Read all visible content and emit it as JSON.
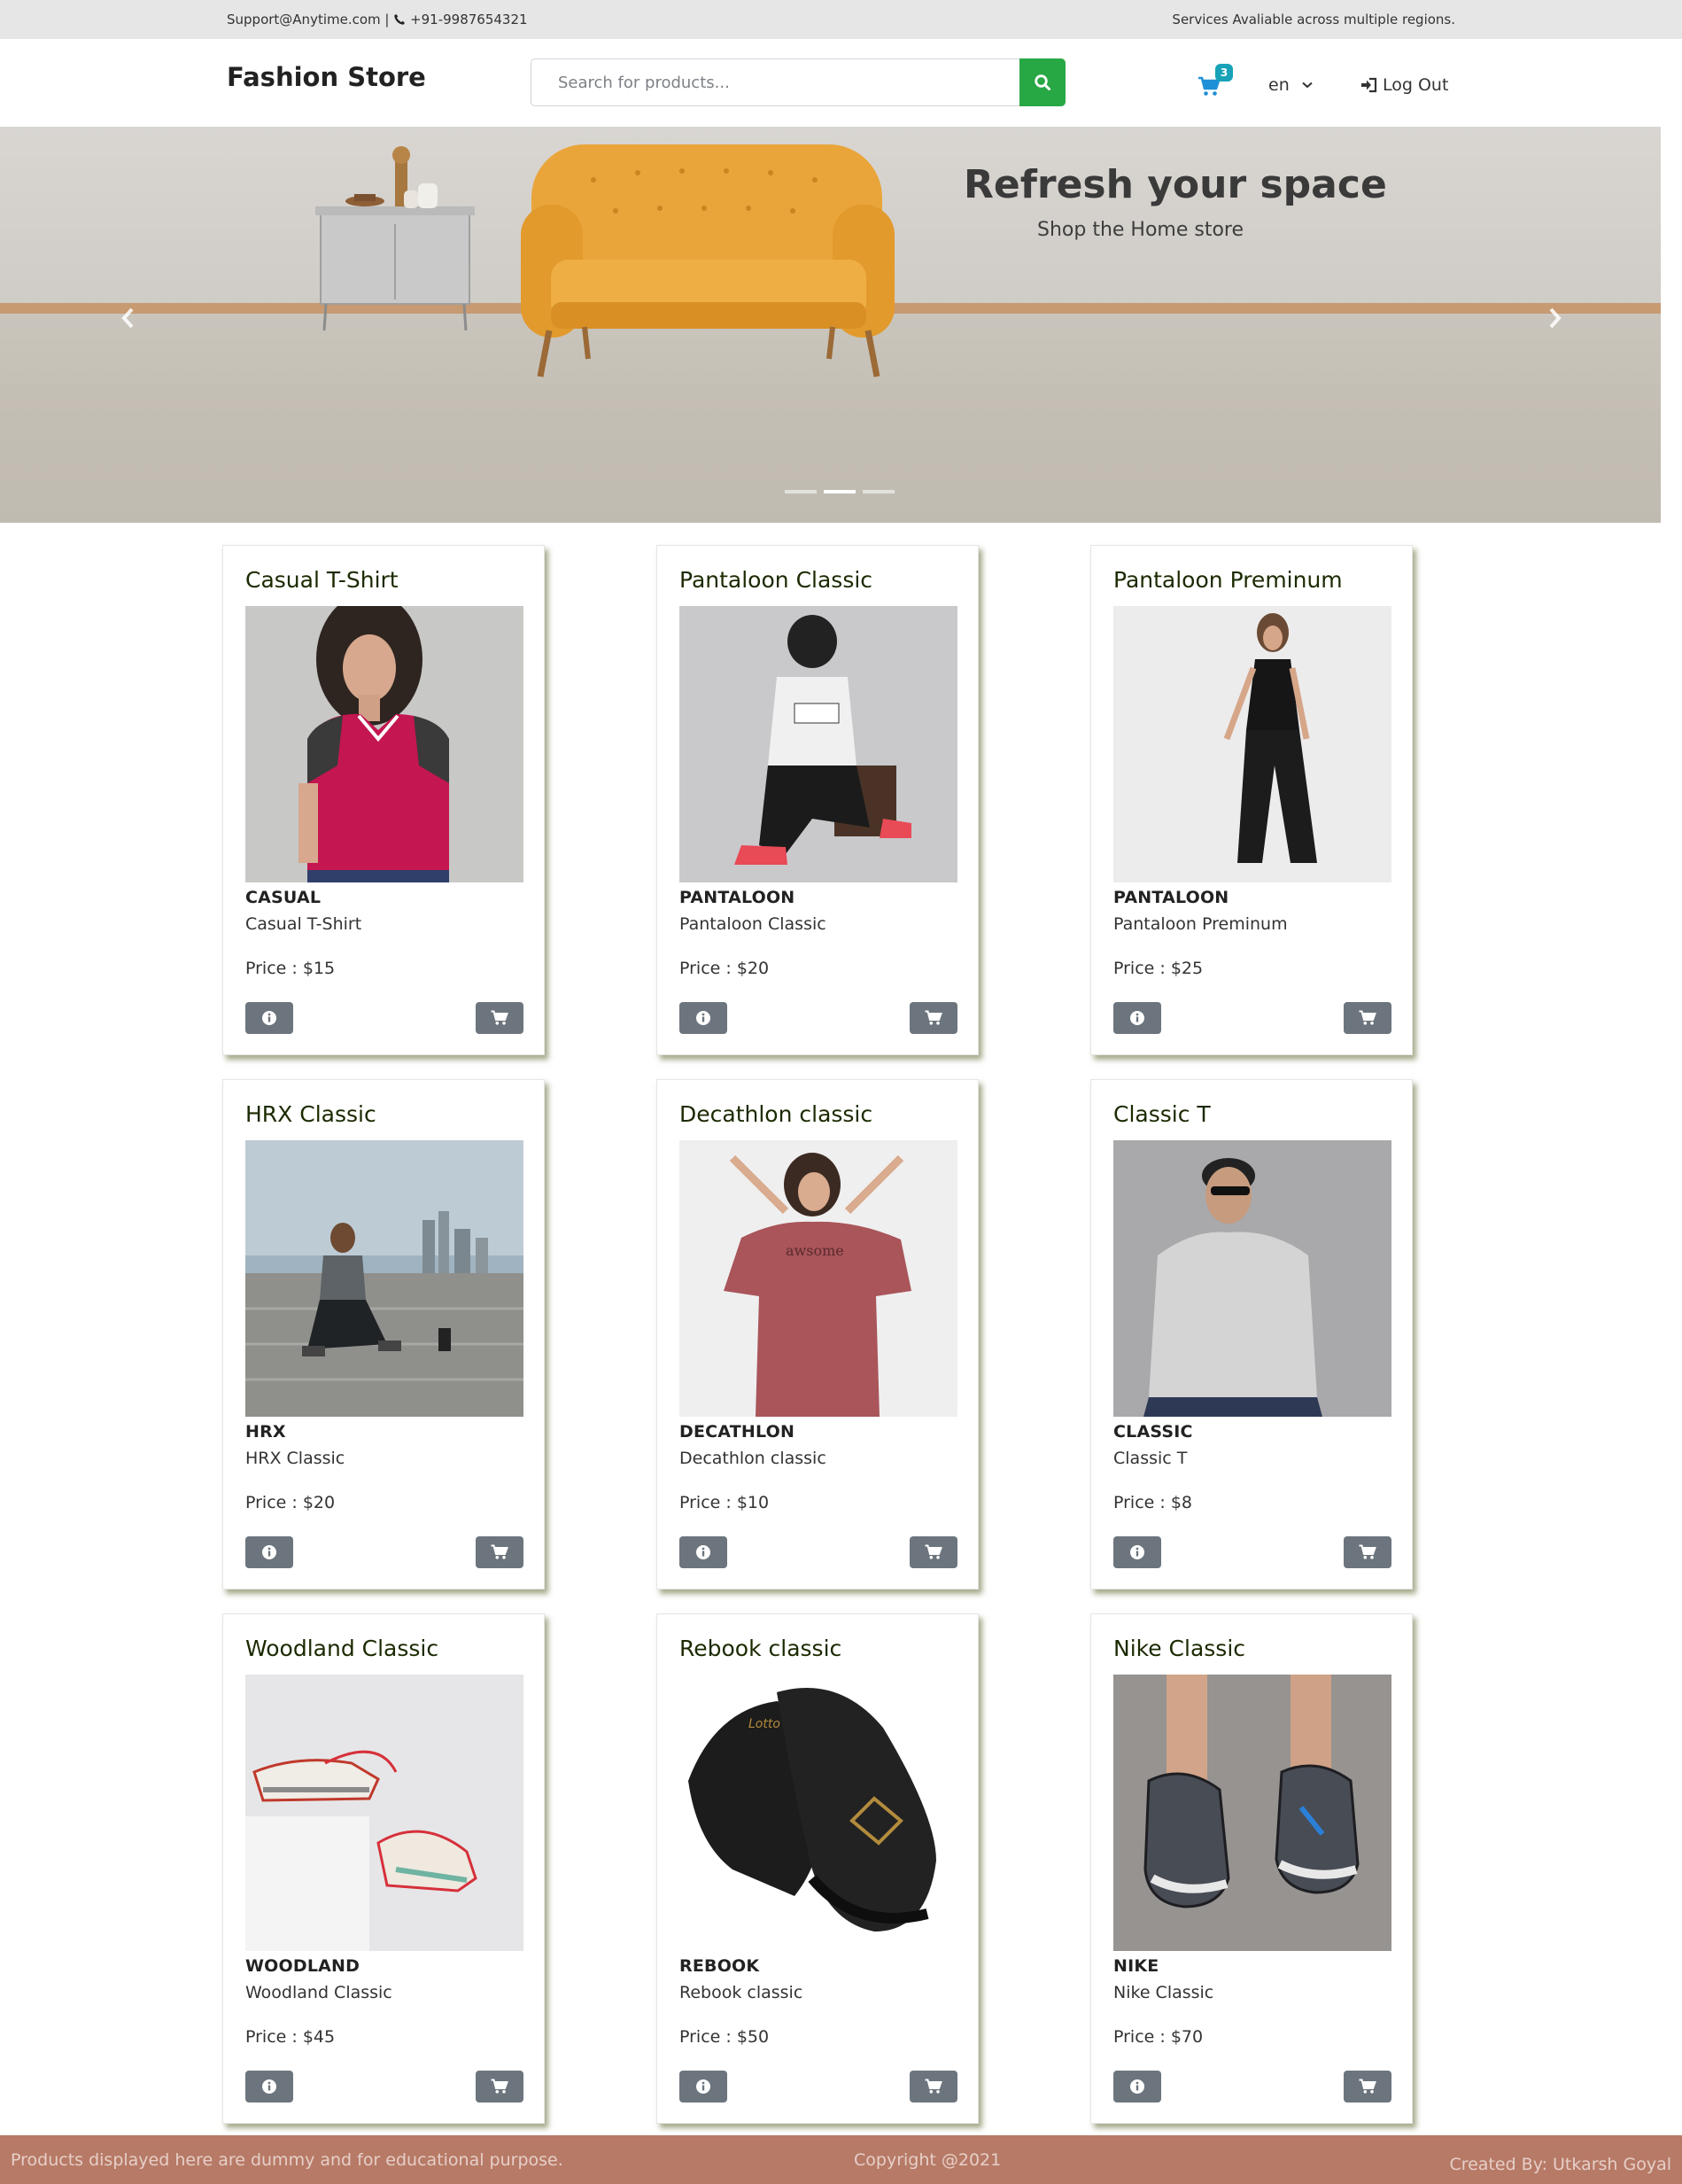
{
  "topbar": {
    "support_email": "Support@Anytime.com",
    "separator": "|",
    "phone": "+91-9987654321",
    "regions": "Services Avaliable across multiple regions."
  },
  "header": {
    "brand": "Fashion Store",
    "search_placeholder": "Search for products...",
    "cart_count": "3",
    "language": "en",
    "logout_label": "Log Out"
  },
  "hero": {
    "title": "Refresh your space",
    "subtitle": "Shop the Home store",
    "active_slide": 2,
    "slide_count": 3
  },
  "products": [
    {
      "title": "Casual T-Shirt",
      "brand": "CASUAL",
      "name": "Casual T-Shirt",
      "price": "Price : $15"
    },
    {
      "title": "Pantaloon Classic",
      "brand": "PANTALOON",
      "name": "Pantaloon Classic",
      "price": "Price : $20"
    },
    {
      "title": "Pantaloon Preminum",
      "brand": "PANTALOON",
      "name": "Pantaloon Preminum",
      "price": "Price : $25"
    },
    {
      "title": "HRX Classic",
      "brand": "HRX",
      "name": "HRX Classic",
      "price": "Price : $20"
    },
    {
      "title": "Decathlon classic",
      "brand": "DECATHLON",
      "name": "Decathlon classic",
      "price": "Price : $10"
    },
    {
      "title": "Classic T",
      "brand": "CLASSIC",
      "name": "Classic T",
      "price": "Price : $8"
    },
    {
      "title": "Woodland Classic",
      "brand": "WOODLAND",
      "name": "Woodland Classic",
      "price": "Price : $45"
    },
    {
      "title": "Rebook classic",
      "brand": "REBOOK",
      "name": "Rebook classic",
      "price": "Price : $50"
    },
    {
      "title": "Nike Classic",
      "brand": "NIKE",
      "name": "Nike Classic",
      "price": "Price : $70"
    }
  ],
  "footer": {
    "disclaimer": "Products displayed here are dummy and for educational purpose.",
    "copyright": "Copyright @2021",
    "credit": "Created By: Utkarsh Goyal"
  },
  "colors": {
    "search_button": "#28a745",
    "cart_icon": "#1e90d8",
    "badge": "#17a2b8",
    "card_button": "#6c757d",
    "footer": "#b77a66"
  }
}
